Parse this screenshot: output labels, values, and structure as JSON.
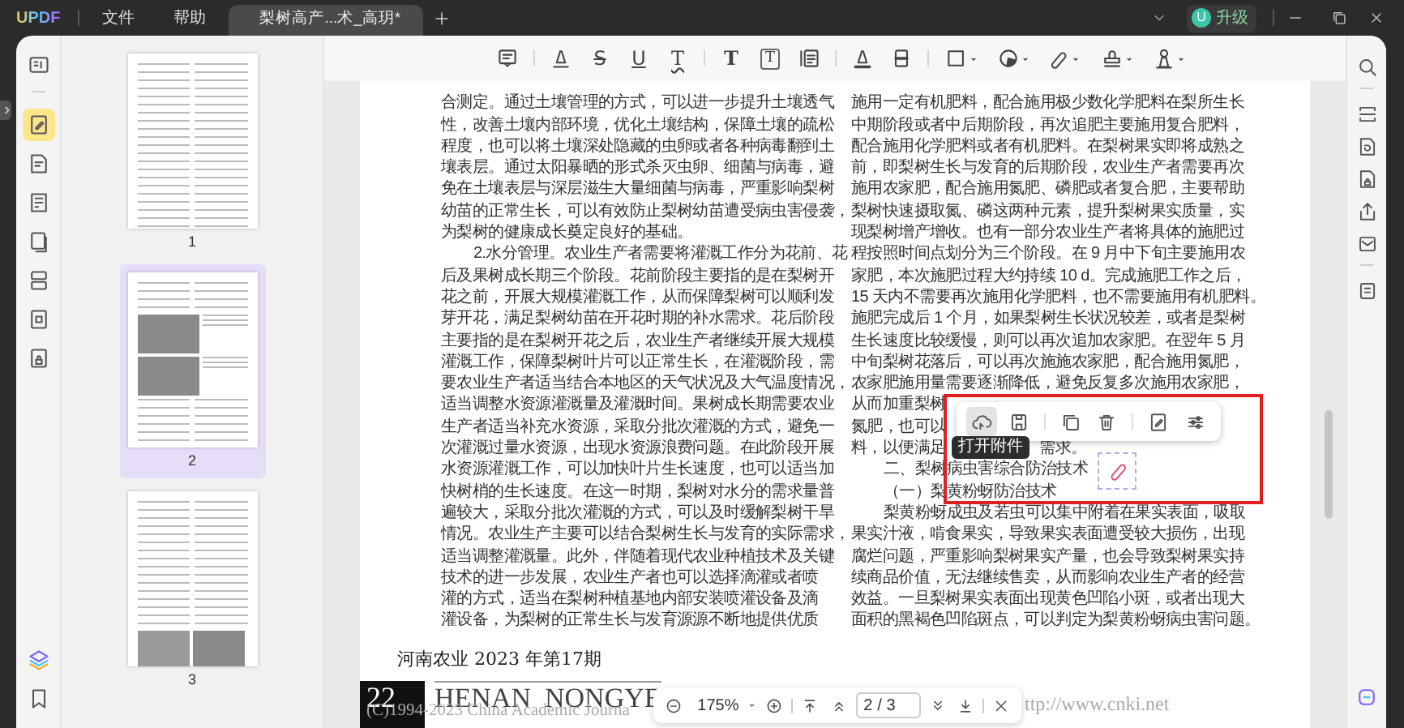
{
  "title_bar": {
    "logo": "UPDF",
    "menu": [
      "文件",
      "帮助"
    ],
    "tabs": [
      {
        "label": "梨树高产...术_高玥*",
        "selected": true
      }
    ],
    "account": {
      "initial": "U",
      "label": "升级"
    }
  },
  "left_rail": [
    {
      "kind": "reader",
      "selected": false
    },
    {
      "kind": "comment",
      "selected": true
    },
    {
      "kind": "edit",
      "selected": false
    },
    {
      "kind": "form",
      "selected": false
    },
    {
      "kind": "page",
      "selected": false
    },
    {
      "kind": "organize",
      "selected": false
    },
    {
      "kind": "crop",
      "selected": false
    },
    {
      "kind": "protect",
      "selected": false
    }
  ],
  "thumbnails": [
    {
      "label": "1",
      "selected": false,
      "kind": "text"
    },
    {
      "label": "2",
      "selected": true,
      "kind": "photo"
    },
    {
      "label": "3",
      "selected": false,
      "kind": "photo_bottom"
    }
  ],
  "toolbar": [
    {
      "kind": "note"
    },
    {
      "kind": "sep"
    },
    {
      "kind": "highlight"
    },
    {
      "kind": "strikethrough",
      "glyph": "S"
    },
    {
      "kind": "underline",
      "glyph": "U"
    },
    {
      "kind": "squiggly",
      "glyph": "T"
    },
    {
      "kind": "sep"
    },
    {
      "kind": "text",
      "glyph": "T"
    },
    {
      "kind": "textbox",
      "glyph": "T"
    },
    {
      "kind": "callout"
    },
    {
      "kind": "sep"
    },
    {
      "kind": "pencil"
    },
    {
      "kind": "eraser"
    },
    {
      "kind": "sep"
    },
    {
      "kind": "rectangle"
    },
    {
      "kind": "shape"
    },
    {
      "kind": "tag"
    },
    {
      "kind": "stamp"
    },
    {
      "kind": "signature"
    }
  ],
  "page": {
    "left_column": [
      {
        "text": "合测定。通过土壤管理的方式，可以进一步提升土壤透气",
        "kind": "line"
      },
      {
        "text": "性，改善土壤内部环境，优化土壤结构，保障土壤的疏松",
        "kind": "line"
      },
      {
        "text": "程度，也可以将土壤深处隐藏的虫卵或者各种病毒翻到土",
        "kind": "line"
      },
      {
        "text": "壤表层。通过太阳暴晒的形式杀灭虫卵、细菌与病毒，避",
        "kind": "line"
      },
      {
        "text": "免在土壤表层与深层滋生大量细菌与病毒，严重影响梨树",
        "kind": "line"
      },
      {
        "text": "幼苗的正常生长，可以有效防止梨树幼苗遭受病虫害侵袭，",
        "kind": "line"
      },
      {
        "text": "为梨树的健康成长奠定良好的基础。",
        "kind": "line"
      },
      {
        "text": "2.水分管理。农业生产者需要将灌溉工作分为花前、花",
        "kind": "first"
      },
      {
        "text": "后及果树成长期三个阶段。花前阶段主要指的是在梨树开",
        "kind": "line"
      },
      {
        "text": "花之前，开展大规模灌溉工作，从而保障梨树可以顺利发",
        "kind": "line"
      },
      {
        "text": "芽开花，满足梨树幼苗在开花时期的补水需求。花后阶段",
        "kind": "line"
      },
      {
        "text": "主要指的是在梨树开花之后，农业生产者继续开展大规模",
        "kind": "line"
      },
      {
        "text": "灌溉工作，保障梨树叶片可以正常生长，在灌溉阶段，需",
        "kind": "line"
      },
      {
        "text": "要农业生产者适当结合本地区的天气状况及大气温度情况，",
        "kind": "line"
      },
      {
        "text": "适当调整水资源灌溉量及灌溉时间。果树成长期需要农业",
        "kind": "line"
      },
      {
        "text": "生产者适当补充水资源，采取分批次灌溉的方式，避免一",
        "kind": "line"
      },
      {
        "text": "次灌溉过量水资源，出现水资源浪费问题。在此阶段开展",
        "kind": "line"
      },
      {
        "text": "水资源灌溉工作，可以加快叶片生长速度，也可以适当加",
        "kind": "line"
      },
      {
        "text": "快树梢的生长速度。在这一时期，梨树对水分的需求量普",
        "kind": "line"
      },
      {
        "text": "遍较大，采取分批次灌溉的方式，可以及时缓解梨树干旱",
        "kind": "line"
      },
      {
        "text": "情况。农业生产主要可以结合梨树生长与发育的实际需求，",
        "kind": "line"
      },
      {
        "text": "适当调整灌溉量。此外，伴随着现代农业种植技术及关键",
        "kind": "line"
      },
      {
        "text": "技术的进一步发展，农业生产者也可以选择滴灌或者喷",
        "kind": "line"
      },
      {
        "text": "灌的方式，适当在梨树种植基地内部安装喷灌设备及滴",
        "kind": "line"
      },
      {
        "text": "灌设备，为梨树的正常生长与发育源源不断地提供优质",
        "kind": "line"
      }
    ],
    "right_column": [
      {
        "text": "施用一定有机肥料，配合施用极少数化学肥料在梨所生长",
        "kind": "line"
      },
      {
        "text": "中期阶段或者中后期阶段，再次追肥主要施用复合肥料，",
        "kind": "line"
      },
      {
        "text": "配合施用化学肥料或者有机肥料。在梨树果实即将成熟之",
        "kind": "line"
      },
      {
        "text": "前，即梨树生长与发育的后期阶段，农业生产者需要再次",
        "kind": "line"
      },
      {
        "text": "施用农家肥，配合施用氮肥、磷肥或者复合肥，主要帮助",
        "kind": "line"
      },
      {
        "text": "梨树快速摄取氮、磷这两种元素，提升梨树果实质量，实",
        "kind": "line"
      },
      {
        "text": "现梨树增产增收。也有一部分农业生产者将具体的施肥过",
        "kind": "line"
      },
      {
        "text": "程按照时间点划分为三个阶段。在 9 月中下旬主要施用农",
        "kind": "line"
      },
      {
        "text": "家肥，本次施肥过程大约持续 10 d。完成施肥工作之后，",
        "kind": "line"
      },
      {
        "text": "15 天内不需要再次施用化学肥料，也不需要施用有机肥料。",
        "kind": "line"
      },
      {
        "text": "施肥完成后 1 个月，如果梨树生长状况较差，或者是梨树",
        "kind": "line"
      },
      {
        "text": "生长速度比较缓慢，则可以再次追加农家肥。在翌年 5 月",
        "kind": "line"
      },
      {
        "text": "中旬梨树花落后，可以再次施施农家肥，配合施用氮肥，",
        "kind": "line"
      },
      {
        "text": "农家肥施用量需要逐渐降低，避免反复多次施用农家肥，",
        "kind": "line"
      },
      {
        "text": "从而加重梨树",
        "kind": "line"
      },
      {
        "text": "氮肥，也可以",
        "kind": "line"
      },
      {
        "text": "料，以便满足",
        "kind": "line",
        "tail": "需求。"
      },
      {
        "text": "二、梨树病虫害综合防治技术",
        "kind": "first",
        "attachment": true
      },
      {
        "text": "（一）梨黄粉蚜防治技术",
        "kind": "first"
      },
      {
        "text": "梨黄粉蚜成虫及若虫可以集中附着在果实表面，吸取",
        "kind": "first"
      },
      {
        "text": "果实汁液，啃食果实，导致果实表面遭受较大损伤，出现",
        "kind": "line"
      },
      {
        "text": "腐烂问题，严重影响梨树果实产量，也会导致梨树果实持",
        "kind": "line"
      },
      {
        "text": "续商品价值，无法继续售卖，从而影响农业生产者的经营",
        "kind": "line"
      },
      {
        "text": "效益。一旦梨树果实表面出现黄色凹陷小斑，或者出现大",
        "kind": "line"
      },
      {
        "text": "面积的黑褐色凹陷斑点，可以判定为梨黄粉蚜病虫害问题。",
        "kind": "line"
      }
    ],
    "footer": {
      "issue": "河南农业 2023 年第17期",
      "page_number": "22",
      "journal": "HENAN  NONGYE",
      "copyright": "(C)1994-2023 China Academic Journa",
      "url": "ttp://www.cnki.net"
    }
  },
  "popup": {
    "buttons": [
      {
        "kind": "attachment",
        "selected": true
      },
      {
        "kind": "save",
        "selected": false
      },
      {
        "kind": "sep"
      },
      {
        "kind": "copy",
        "selected": false
      },
      {
        "kind": "delete",
        "selected": false
      },
      {
        "kind": "sep"
      },
      {
        "kind": "comment",
        "selected": false
      },
      {
        "kind": "settings",
        "selected": false
      }
    ],
    "tooltip": "打开附件"
  },
  "zoom_bar": {
    "zoom": "175%",
    "page": "2",
    "total": "/ 3"
  }
}
